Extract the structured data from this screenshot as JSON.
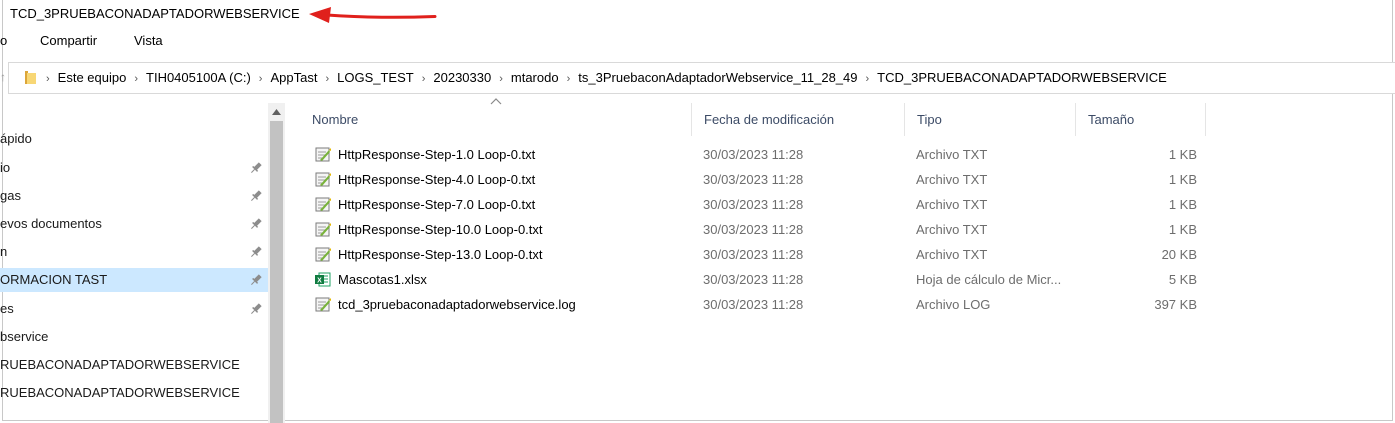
{
  "window": {
    "title": "TCD_3PRUEBACONADAPTADORWEBSERVICE"
  },
  "ribbon": {
    "tab_file": "o",
    "tab_share": "Compartir",
    "tab_view": "Vista"
  },
  "breadcrumb": {
    "items": [
      "Este equipo",
      "TIH0405100A (C:)",
      "AppTast",
      "LOGS_TEST",
      "20230330",
      "mtarodo",
      "ts_3PruebaconAdaptadorWebservice_11_28_49",
      "TCD_3PRUEBACONADAPTADORWEBSERVICE"
    ],
    "separator": "›"
  },
  "nav": {
    "items": [
      {
        "label": "ápido",
        "pinned": false,
        "selected": false
      },
      {
        "label": "io",
        "pinned": true,
        "selected": false
      },
      {
        "label": "gas",
        "pinned": true,
        "selected": false
      },
      {
        "label": "evos documentos",
        "pinned": true,
        "selected": false
      },
      {
        "label": "n",
        "pinned": true,
        "selected": false
      },
      {
        "label": "ORMACION TAST",
        "pinned": true,
        "selected": true
      },
      {
        "label": "es",
        "pinned": true,
        "selected": false
      },
      {
        "label": "bservice",
        "pinned": false,
        "selected": false
      },
      {
        "label": "RUEBACONADAPTADORWEBSERVICE",
        "pinned": false,
        "selected": false
      },
      {
        "label": "RUEBACONADAPTADORWEBSERVICE",
        "pinned": false,
        "selected": false
      }
    ]
  },
  "columns": {
    "name": "Nombre",
    "date": "Fecha de modificación",
    "type": "Tipo",
    "size": "Tamaño"
  },
  "files": [
    {
      "name": "HttpResponse-Step-1.0 Loop-0.txt",
      "date": "30/03/2023 11:28",
      "type": "Archivo TXT",
      "size": "1 KB",
      "icon": "text-file-icon"
    },
    {
      "name": "HttpResponse-Step-4.0 Loop-0.txt",
      "date": "30/03/2023 11:28",
      "type": "Archivo TXT",
      "size": "1 KB",
      "icon": "text-file-icon"
    },
    {
      "name": "HttpResponse-Step-7.0 Loop-0.txt",
      "date": "30/03/2023 11:28",
      "type": "Archivo TXT",
      "size": "1 KB",
      "icon": "text-file-icon"
    },
    {
      "name": "HttpResponse-Step-10.0 Loop-0.txt",
      "date": "30/03/2023 11:28",
      "type": "Archivo TXT",
      "size": "1 KB",
      "icon": "text-file-icon"
    },
    {
      "name": "HttpResponse-Step-13.0 Loop-0.txt",
      "date": "30/03/2023 11:28",
      "type": "Archivo TXT",
      "size": "20 KB",
      "icon": "text-file-icon"
    },
    {
      "name": "Mascotas1.xlsx",
      "date": "30/03/2023 11:28",
      "type": "Hoja de cálculo de Micr...",
      "size": "5 KB",
      "icon": "excel-file-icon"
    },
    {
      "name": "tcd_3pruebaconadaptadorwebservice.log",
      "date": "30/03/2023 11:28",
      "type": "Archivo LOG",
      "size": "397 KB",
      "icon": "text-file-icon"
    }
  ],
  "colors": {
    "arrow": "#e0201c",
    "selected": "#cce8ff",
    "header_text": "#3c4b66",
    "muted_text": "#6d6d6d"
  }
}
